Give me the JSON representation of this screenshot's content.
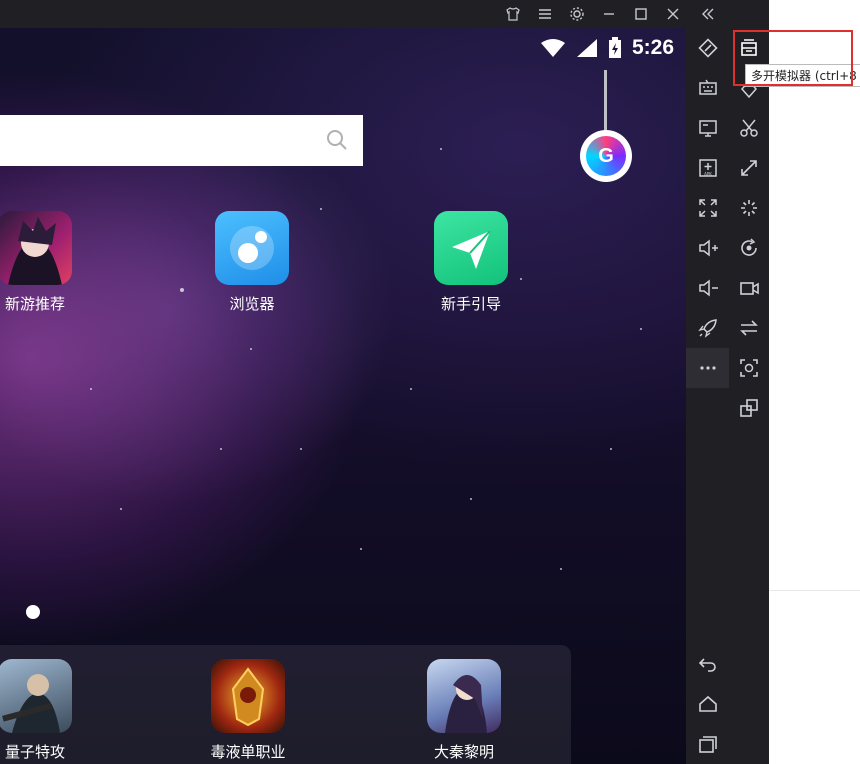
{
  "window": {
    "title_buttons": [
      "skin-icon",
      "menu-icon",
      "settings-icon",
      "minimize-icon",
      "maximize-icon",
      "close-icon",
      "collapse-icon"
    ]
  },
  "status_bar": {
    "time": "5:26"
  },
  "search": {
    "placeholder": ""
  },
  "apps": [
    {
      "label": "新游推荐",
      "icon": "new-games-icon"
    },
    {
      "label": "浏览器",
      "icon": "browser-icon"
    },
    {
      "label": "新手引导",
      "icon": "beginner-guide-icon"
    }
  ],
  "dock": [
    {
      "label": "量子特攻",
      "icon": "quantum-strike-icon"
    },
    {
      "label": "毒液单职业",
      "icon": "venom-icon"
    },
    {
      "label": "大秦黎明",
      "icon": "qin-dawn-icon"
    }
  ],
  "toolbar1": [
    "rotate-icon",
    "keyboard-icon",
    "screen-icon",
    "apk-install-icon",
    "fullscreen-icon",
    "volume-up-icon",
    "volume-down-icon",
    "rocket-icon",
    "more-icon"
  ],
  "toolbar1_bottom": [
    "back-icon",
    "home-icon",
    "recents-icon"
  ],
  "toolbar2": [
    "multi-instance-icon",
    "location-icon",
    "scissors-icon",
    "resize-icon",
    "loading-icon",
    "sync-icon",
    "record-icon",
    "swap-icon",
    "screenshot-icon",
    "multi-window-icon"
  ],
  "tooltip": {
    "text": "多开模拟器 (ctrl+8"
  },
  "colors": {
    "highlight": "#e0302e",
    "toolbar": "#1f1f24"
  }
}
